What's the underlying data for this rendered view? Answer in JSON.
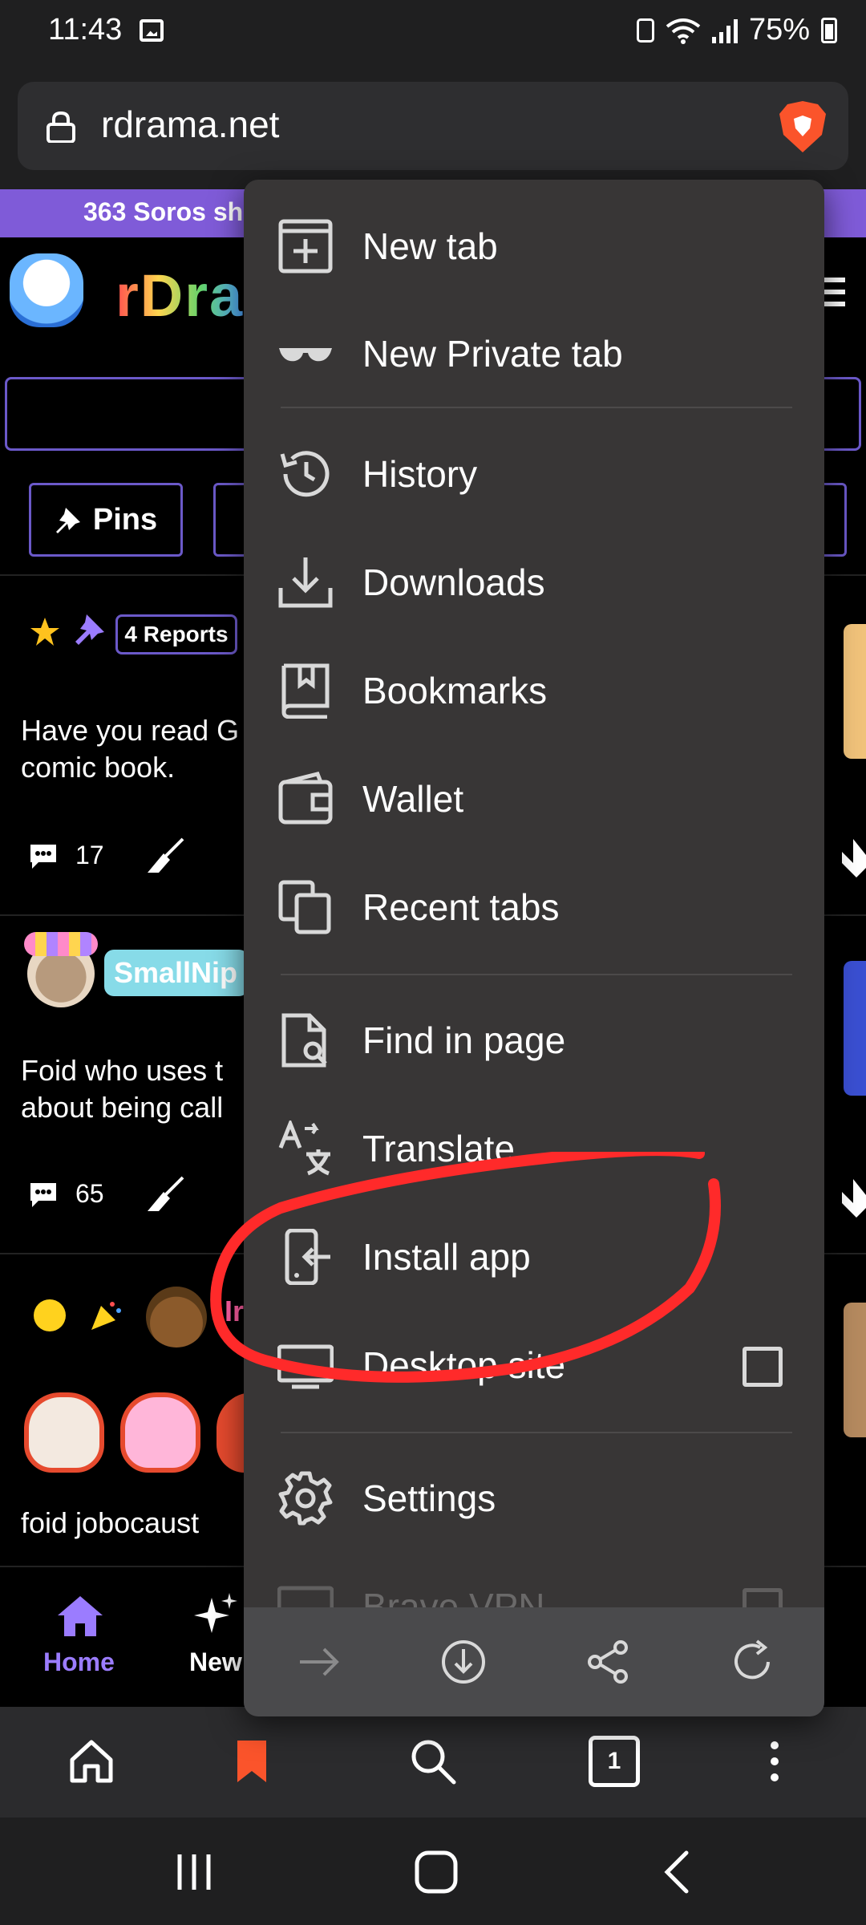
{
  "status_bar": {
    "time": "11:43",
    "battery": "75%"
  },
  "url_bar": {
    "url": "rdrama.net"
  },
  "page": {
    "banner_text": "363 Soros shi",
    "logo_text": "rDra",
    "pins_label": "Pins",
    "posts": [
      {
        "reports": "4 Reports",
        "text_line1": "Have you read G",
        "text_line2": "comic book.",
        "comments": "17"
      },
      {
        "username": "SmallNip",
        "text_line1": "Foid who uses t",
        "text_line2": "about being call",
        "comments": "65"
      },
      {
        "username_partial": "Ir",
        "text_line1": "foid jobocaust"
      }
    ],
    "bottom_nav": {
      "home_label": "Home",
      "new_label": "New"
    }
  },
  "menu": {
    "items": [
      {
        "label": "New tab",
        "icon": "new-tab-icon"
      },
      {
        "label": "New Private tab",
        "icon": "private-glasses-icon"
      },
      {
        "label": "History",
        "icon": "history-icon"
      },
      {
        "label": "Downloads",
        "icon": "download-icon"
      },
      {
        "label": "Bookmarks",
        "icon": "bookmarks-icon"
      },
      {
        "label": "Wallet",
        "icon": "wallet-icon"
      },
      {
        "label": "Recent tabs",
        "icon": "recent-tabs-icon"
      },
      {
        "label": "Find in page",
        "icon": "find-in-page-icon"
      },
      {
        "label": "Translate",
        "icon": "translate-icon"
      },
      {
        "label": "Install app",
        "icon": "install-app-icon"
      },
      {
        "label": "Desktop site",
        "icon": "desktop-icon",
        "checked": false
      },
      {
        "label": "Settings",
        "icon": "gear-icon"
      },
      {
        "label": "Brave VPN",
        "icon": "vpn-icon",
        "checked": false
      }
    ]
  },
  "browser_bar": {
    "tab_count": "1"
  },
  "colors": {
    "menu_bg": "#383636",
    "accent_purple": "#7f5bd8",
    "brave_orange": "#fb542b",
    "annotation_red": "#ff2a2a"
  }
}
